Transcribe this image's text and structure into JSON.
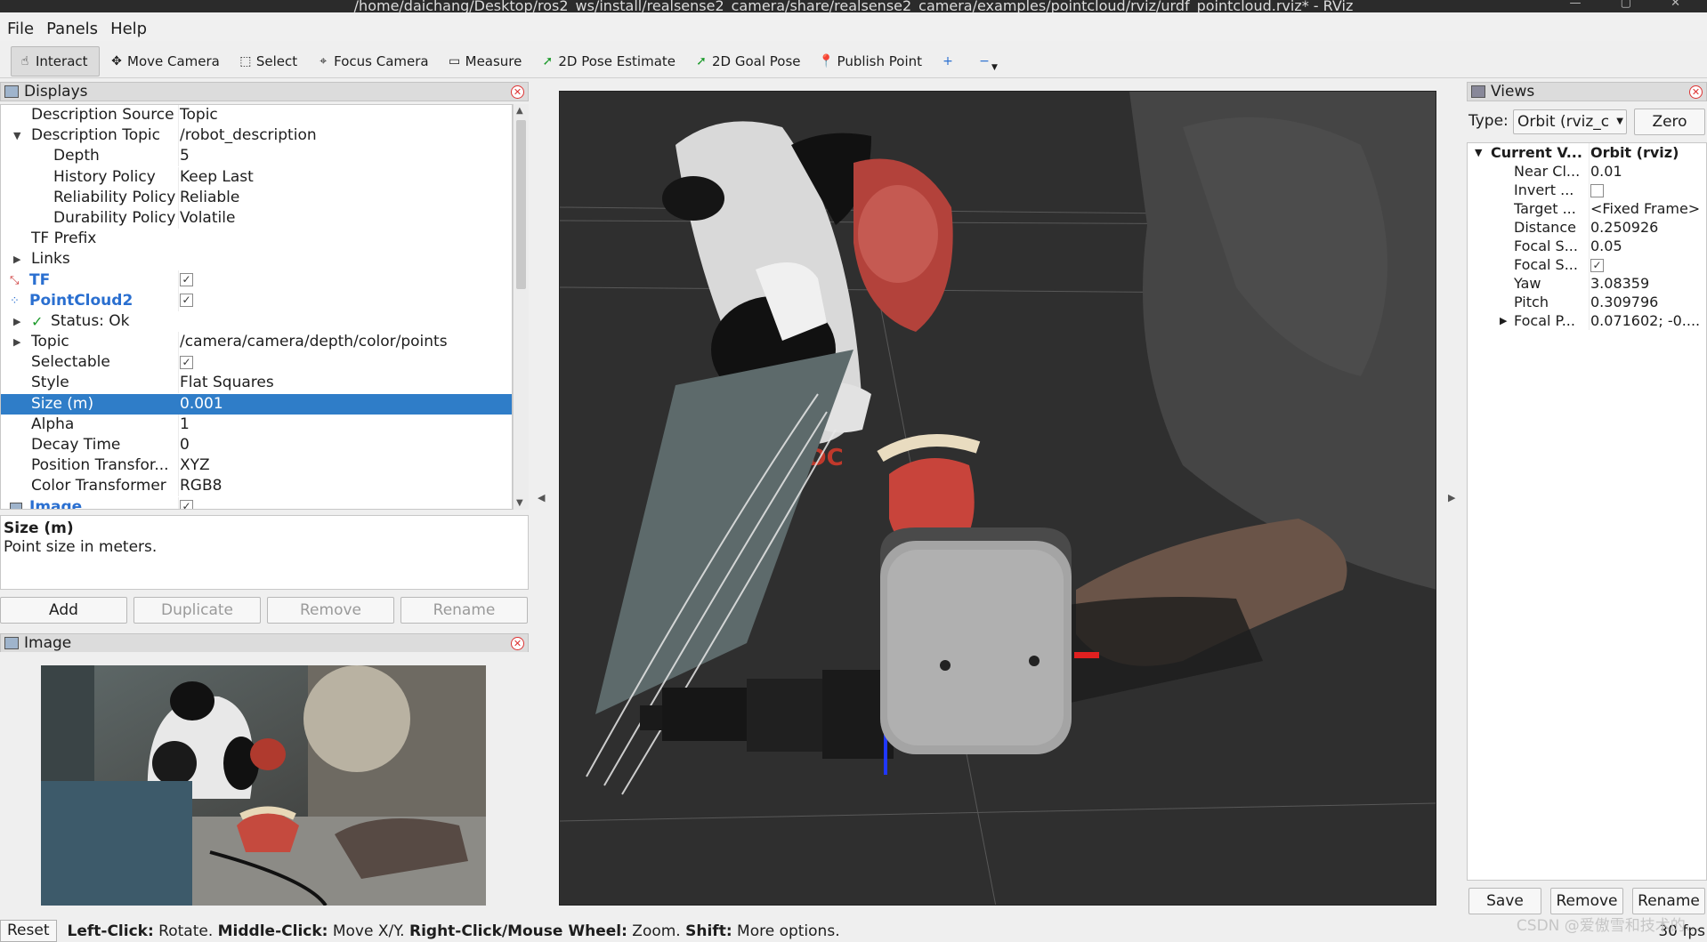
{
  "window": {
    "title": "/home/daichang/Desktop/ros2_ws/install/realsense2_camera/share/realsense2_camera/examples/pointcloud/rviz/urdf_pointcloud.rviz* - RViz"
  },
  "menu": {
    "file": "File",
    "panels": "Panels",
    "help": "Help"
  },
  "toolbar": {
    "interact": "Interact",
    "move_camera": "Move Camera",
    "select": "Select",
    "focus_camera": "Focus Camera",
    "measure": "Measure",
    "pose_estimate": "2D Pose Estimate",
    "goal_pose": "2D Goal Pose",
    "publish_point": "Publish Point",
    "add": "+",
    "remove": "−"
  },
  "displays": {
    "title": "Displays",
    "rows": [
      {
        "name": "Description Source",
        "value": "Topic"
      },
      {
        "name": "Description Topic",
        "value": "/robot_description"
      },
      {
        "name": "Depth",
        "value": "5"
      },
      {
        "name": "History Policy",
        "value": "Keep Last"
      },
      {
        "name": "Reliability Policy",
        "value": "Reliable"
      },
      {
        "name": "Durability Policy",
        "value": "Volatile"
      },
      {
        "name": "TF Prefix",
        "value": ""
      },
      {
        "name": "Links",
        "value": ""
      },
      {
        "name": "TF",
        "value": ""
      },
      {
        "name": "PointCloud2",
        "value": ""
      },
      {
        "name": "Status: Ok",
        "value": ""
      },
      {
        "name": "Topic",
        "value": "/camera/camera/depth/color/points"
      },
      {
        "name": "Selectable",
        "value": ""
      },
      {
        "name": "Style",
        "value": "Flat Squares"
      },
      {
        "name": "Size (m)",
        "value": "0.001"
      },
      {
        "name": "Alpha",
        "value": "1"
      },
      {
        "name": "Decay Time",
        "value": "0"
      },
      {
        "name": "Position Transfor...",
        "value": "XYZ"
      },
      {
        "name": "Color Transformer",
        "value": "RGB8"
      },
      {
        "name": "Image",
        "value": ""
      }
    ],
    "desc_title": "Size (m)",
    "desc_text": "Point size in meters.",
    "buttons": {
      "add": "Add",
      "duplicate": "Duplicate",
      "remove": "Remove",
      "rename": "Rename"
    }
  },
  "image_panel": {
    "title": "Image"
  },
  "views": {
    "title": "Views",
    "type_label": "Type:",
    "type_value": "Orbit (rviz_c",
    "zero": "Zero",
    "rows": [
      {
        "name": "Current V...",
        "value": "Orbit (rviz)"
      },
      {
        "name": "Near Cl...",
        "value": "0.01"
      },
      {
        "name": "Invert ...",
        "value": ""
      },
      {
        "name": "Target ...",
        "value": "<Fixed Frame>"
      },
      {
        "name": "Distance",
        "value": "0.250926"
      },
      {
        "name": "Focal S...",
        "value": "0.05"
      },
      {
        "name": "Focal S...",
        "value": ""
      },
      {
        "name": "Yaw",
        "value": "3.08359"
      },
      {
        "name": "Pitch",
        "value": "0.309796"
      },
      {
        "name": "Focal P...",
        "value": "0.071602; -0...."
      }
    ],
    "buttons": {
      "save": "Save",
      "remove": "Remove",
      "rename": "Rename"
    }
  },
  "status": {
    "reset": "Reset",
    "k1": "Left-Click:",
    "v1": " Rotate. ",
    "k2": "Middle-Click:",
    "v2": " Move X/Y. ",
    "k3": "Right-Click/Mouse Wheel:",
    "v3": " Zoom. ",
    "k4": "Shift:",
    "v4": " More options.",
    "fps": "30 fps"
  },
  "watermark": "CSDN @爱傲雪和技术的..."
}
